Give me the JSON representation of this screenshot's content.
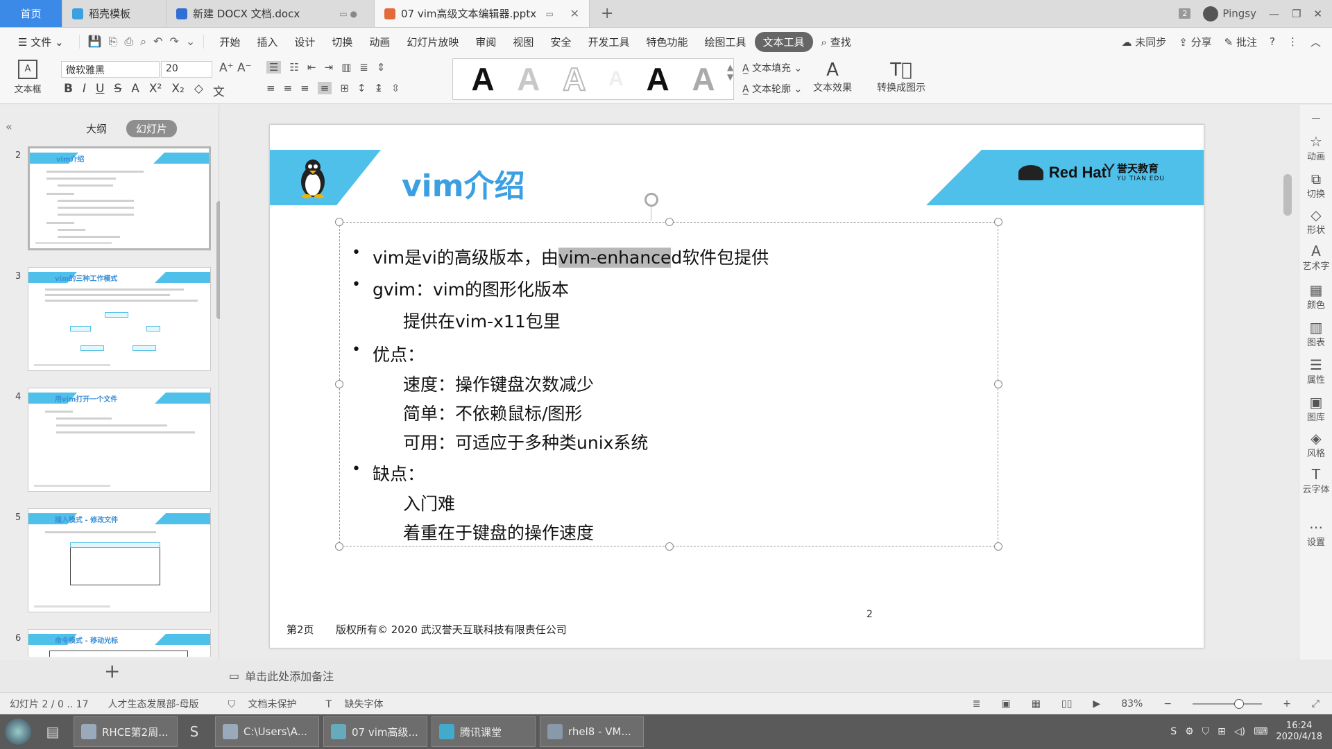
{
  "tabs": {
    "home": "首页",
    "t1": "稻壳模板",
    "t2": "新建 DOCX 文档.docx",
    "active": "07 vim高级文本编辑器.pptx",
    "badge": "2",
    "user": "Pingsy"
  },
  "menu": {
    "file": "文件",
    "items": [
      "开始",
      "插入",
      "设计",
      "切换",
      "动画",
      "幻灯片放映",
      "审阅",
      "视图",
      "安全",
      "开发工具",
      "特色功能",
      "绘图工具",
      "文本工具"
    ],
    "active_index": 12,
    "search": "查找",
    "right": [
      "未同步",
      "分享",
      "批注"
    ]
  },
  "ribbon": {
    "textbox": "文本框",
    "font": "微软雅黑",
    "size": "20",
    "art_letter": "A",
    "fill": "文本填充",
    "outline": "文本轮廓",
    "effect": "文本效果",
    "convert": "转换成图示"
  },
  "leftpanel": {
    "tab_outline": "大纲",
    "tab_slides": "幻灯片",
    "thumbs": [
      {
        "num": "2",
        "title": "vim介绍"
      },
      {
        "num": "3",
        "title": "vim的三种工作模式"
      },
      {
        "num": "4",
        "title": "用vim打开一个文件"
      },
      {
        "num": "5",
        "title": "插入模式 - 修改文件"
      },
      {
        "num": "6",
        "title": "命令模式 - 移动光标"
      }
    ]
  },
  "slide": {
    "title": "vim介绍",
    "brand": "Red Hat",
    "edu_cn": "誉天教育",
    "edu_en": "YU TIAN EDU",
    "line1_pre": "vim是vi的高级版本，由",
    "line1_hl": "vim-enhance",
    "line1_post": "d软件包提供",
    "line2": "gvim：vim的图形化版本",
    "line3": "提供在vim-x11包里",
    "line4": "优点：",
    "line5": "速度：操作键盘次数减少",
    "line6": "简单：不依赖鼠标/图形",
    "line7": "可用：可适应于多种类unix系统",
    "line8": "缺点：",
    "line9": "入门难",
    "line10": "着重在于键盘的操作速度",
    "footer_page": "第2页",
    "footer_copy": "版权所有© 2020 武汉誉天互联科技有限责任公司",
    "page_num": "2"
  },
  "notes": "单击此处添加备注",
  "rightbar": [
    "动画",
    "切换",
    "形状",
    "艺术字",
    "颜色",
    "图表",
    "属性",
    "图库",
    "风格",
    "云字体",
    "设置"
  ],
  "status": {
    "slide": "幻灯片 2 / 0 .. 17",
    "theme": "人才生态发展部-母版",
    "protect": "文档未保护",
    "font": "缺失字体",
    "zoom": "83%"
  },
  "taskbar": {
    "tasks": [
      "RHCE第2周...",
      "C:\\Users\\A...",
      "07 vim高级...",
      "腾讯课堂",
      "rhel8 - VM..."
    ],
    "time": "16:24",
    "date": "2020/4/18"
  }
}
